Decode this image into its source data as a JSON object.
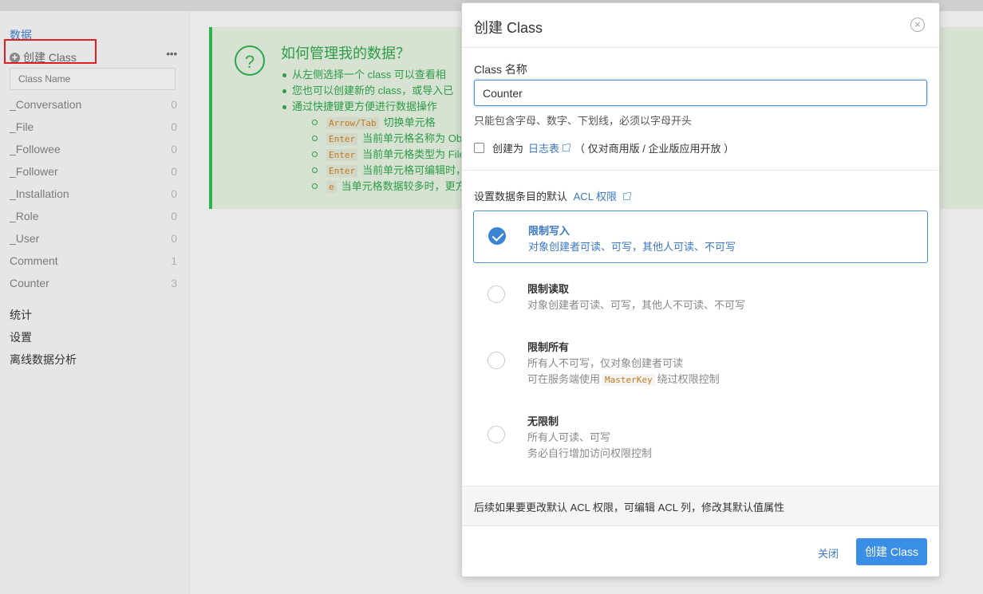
{
  "sidebar": {
    "data_link": "数据",
    "create_class": "创建 Class",
    "more": "•••",
    "search_placeholder": "Class Name",
    "classes": [
      {
        "name": "_Conversation",
        "count": "0"
      },
      {
        "name": "_File",
        "count": "0"
      },
      {
        "name": "_Followee",
        "count": "0"
      },
      {
        "name": "_Follower",
        "count": "0"
      },
      {
        "name": "_Installation",
        "count": "0"
      },
      {
        "name": "_Role",
        "count": "0"
      },
      {
        "name": "_User",
        "count": "0"
      },
      {
        "name": "Comment",
        "count": "1"
      },
      {
        "name": "Counter",
        "count": "3"
      }
    ],
    "nav": [
      "统计",
      "设置",
      "离线数据分析"
    ]
  },
  "help": {
    "icon": "?",
    "title": "如何管理我的数据？",
    "items": [
      "从左侧选择一个 class 可以查看相",
      "您也可以创建新的 class，或导入已",
      "通过快捷键更方便进行数据操作"
    ],
    "shortcuts": [
      {
        "key": "Arrow/Tab",
        "desc": "切换单元格"
      },
      {
        "key": "Enter",
        "desc": "当前单元格名称为 Obje"
      },
      {
        "key": "Enter",
        "desc": "当前单元格类型为 File"
      },
      {
        "key": "Enter",
        "desc": "当前单元格可编辑时，"
      },
      {
        "key": "e",
        "desc": "当单元格数据较多时，更方便"
      }
    ]
  },
  "modal": {
    "title": "创建 Class",
    "close_icon": "×",
    "name_label": "Class 名称",
    "name_value": "Counter",
    "name_hint": "只能包含字母、数字、下划线，必须以字母开头",
    "log_prefix": "创建为",
    "log_link": "日志表",
    "log_suffix": "（ 仅对商用版 / 企业版应用开放 ）",
    "acl_heading": "设置数据条目的默认",
    "acl_link": "ACL 权限",
    "options": [
      {
        "title": "限制写入",
        "lines": [
          "对象创建者可读、可写，其他人可读、不可写"
        ],
        "selected": true
      },
      {
        "title": "限制读取",
        "lines": [
          "对象创建者可读、可写，其他人不可读、不可写"
        ],
        "selected": false
      },
      {
        "title": "限制所有",
        "lines": [
          "所有人不可写，仅对象创建者可读"
        ],
        "line2_prefix": "可在服务端使用",
        "line2_code": "MasterKey",
        "line2_suffix": "绕过权限控制",
        "selected": false
      },
      {
        "title": "无限制",
        "lines": [
          "所有人可读、可写",
          "务必自行增加访问权限控制"
        ],
        "selected": false
      }
    ],
    "footer_note": "后续如果要更改默认 ACL 权限，可编辑 ACL 列，修改其默认值属性",
    "close_button": "关闭",
    "create_button": "创建 Class"
  }
}
